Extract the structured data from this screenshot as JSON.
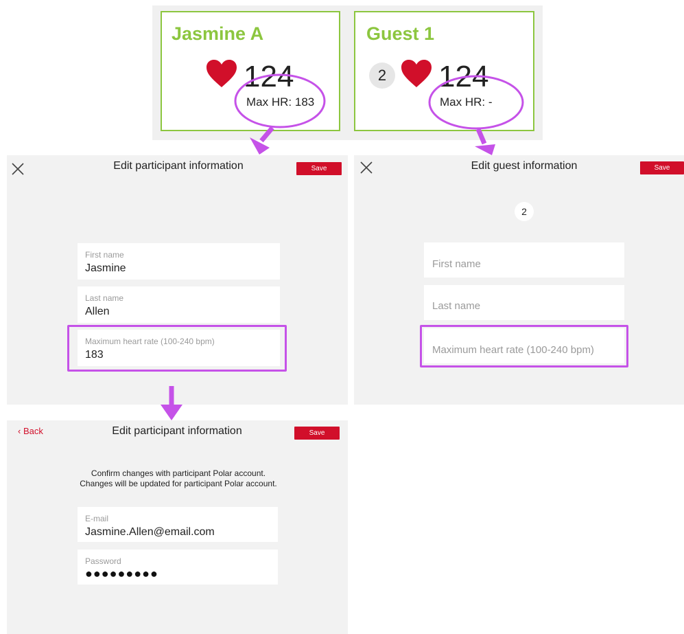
{
  "cards": [
    {
      "name": "Jasmine A",
      "hr": "124",
      "max_hr_label": "Max HR:",
      "max_hr_value": "183"
    },
    {
      "name": "Guest 1",
      "zone": "2",
      "hr": "124",
      "max_hr_label": "Max HR:",
      "max_hr_value": "-"
    }
  ],
  "edit_participant": {
    "title": "Edit participant information",
    "save": "Save",
    "fields": [
      {
        "label": "First name",
        "value": "Jasmine"
      },
      {
        "label": "Last name",
        "value": "Allen"
      },
      {
        "label": "Maximum heart rate (100-240 bpm)",
        "value": "183"
      }
    ]
  },
  "edit_guest": {
    "title": "Edit guest information",
    "save": "Save",
    "zone": "2",
    "fields": [
      {
        "placeholder": "First name"
      },
      {
        "placeholder": "Last name"
      },
      {
        "placeholder": "Maximum heart rate (100-240 bpm)"
      }
    ]
  },
  "confirm": {
    "back": "Back",
    "title": "Edit participant information",
    "save": "Save",
    "message_line1": "Confirm changes with participant Polar account.",
    "message_line2": "Changes will be updated for participant Polar account.",
    "fields": [
      {
        "label": "E-mail",
        "value": "Jasmine.Allen@email.com"
      },
      {
        "label": "Password",
        "value": "●●●●●●●●●"
      }
    ]
  },
  "colors": {
    "brand_green": "#8cc63f",
    "brand_red": "#d10f2a",
    "annotation_purple": "#c552e8",
    "panel_gray": "#f2f2f2"
  }
}
